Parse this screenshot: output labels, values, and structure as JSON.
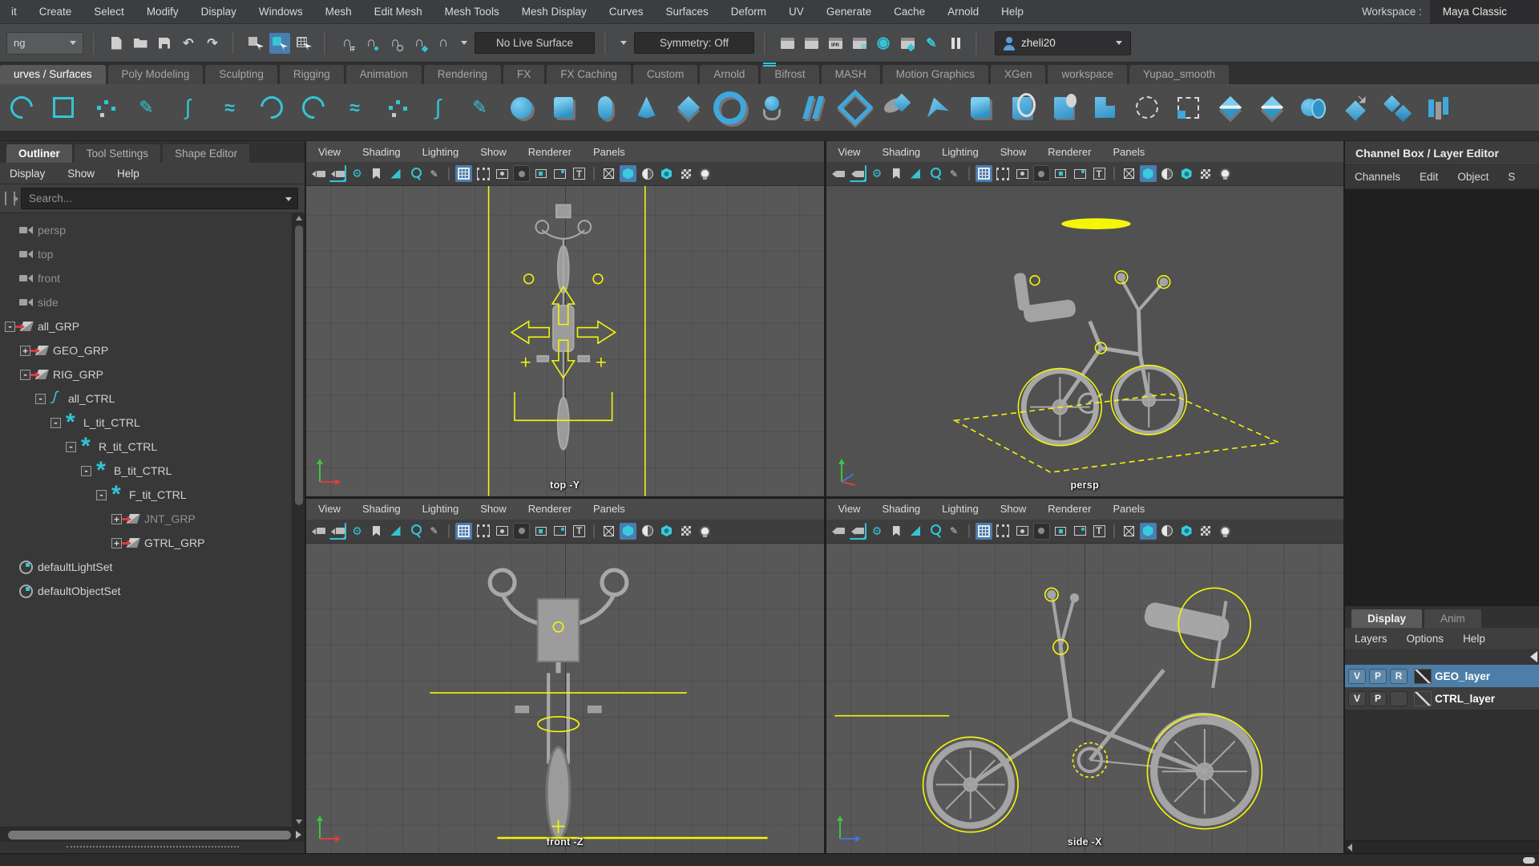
{
  "colors": {
    "accent_teal": "#35c4d6",
    "accent_blue": "#4a7db1",
    "selection_yellow": "#f5f50a",
    "layer_selected": "#4d7ea8"
  },
  "menubar": {
    "items": [
      "it",
      "Create",
      "Select",
      "Modify",
      "Display",
      "Windows",
      "Mesh",
      "Edit Mesh",
      "Mesh Tools",
      "Mesh Display",
      "Curves",
      "Surfaces",
      "Deform",
      "UV",
      "Generate",
      "Cache",
      "Arnold",
      "Help"
    ],
    "workspace_label": "Workspace :",
    "workspace_value": "Maya Classic"
  },
  "statusline": {
    "menuset_value": "ng",
    "file_icons": [
      {
        "n": "new-scene-icon",
        "c": "ic-new"
      },
      {
        "n": "open-scene-icon",
        "c": "ic-open"
      },
      {
        "n": "save-scene-icon",
        "c": "ic-save"
      },
      {
        "n": "undo-icon",
        "c": "ic-glyph",
        "g": "↶"
      },
      {
        "n": "redo-icon",
        "c": "ic-glyph",
        "g": "↷"
      }
    ],
    "select_icons": [
      {
        "n": "select-by-hierarchy-icon",
        "c": "ic-selhier"
      },
      {
        "n": "select-by-object-icon",
        "c": "ic-selobj on"
      },
      {
        "n": "select-by-component-icon",
        "c": "ic-selcomp"
      }
    ],
    "snap_icons": [
      {
        "n": "snap-to-grid-icon",
        "c": "ic-mag sub-grid",
        "g": "∩"
      },
      {
        "n": "snap-to-curve-icon",
        "c": "ic-mag sub-dot",
        "g": "∩"
      },
      {
        "n": "snap-to-point-icon",
        "c": "ic-mag sub-ring",
        "g": "∩"
      },
      {
        "n": "snap-to-projected-center-ic",
        "c": "ic-mag sub-diamond",
        "g": "∩"
      },
      {
        "n": "snap-to-view-plane-icon",
        "c": "ic-mag",
        "g": "∩"
      }
    ],
    "live_surface": "No Live Surface",
    "symmetry": "Symmetry: Off",
    "render_icons": [
      {
        "n": "render-current-frame-icon",
        "c": "ic-clap"
      },
      {
        "n": "render-region-icon",
        "c": "ic-clap"
      },
      {
        "n": "ipr-render-icon",
        "c": "ic-clap ipr"
      },
      {
        "n": "render-settings-icon",
        "c": "ic-clap gear"
      },
      {
        "n": "render-view-icon",
        "c": "ic-glyph teal big",
        "g": "◉"
      },
      {
        "n": "sequence-render-icon",
        "c": "ic-clap diam"
      },
      {
        "n": "paint-effects-icon",
        "c": "ic-glyph teal",
        "g": "✎"
      },
      {
        "n": "pause-ipr-icon",
        "c": "ic-pause"
      }
    ],
    "user": "zheli20"
  },
  "shelf": {
    "tabs": [
      {
        "label": "urves / Surfaces",
        "cls": "active"
      },
      {
        "label": "Poly Modeling"
      },
      {
        "label": "Sculpting"
      },
      {
        "label": "Rigging"
      },
      {
        "label": "Animation"
      },
      {
        "label": "Rendering"
      },
      {
        "label": "FX"
      },
      {
        "label": "FX Caching"
      },
      {
        "label": "Custom"
      },
      {
        "label": "Arnold"
      },
      {
        "label": "Bifrost"
      },
      {
        "label": "MASH"
      },
      {
        "label": "Motion Graphics"
      },
      {
        "label": "XGen"
      },
      {
        "label": "workspace"
      },
      {
        "label": "Yupao_smooth"
      }
    ],
    "icons": [
      {
        "n": "nurbs-circle-icon",
        "c": "s-arc"
      },
      {
        "n": "nurbs-square-icon",
        "c": "s-square"
      },
      {
        "n": "ep-curve-icon",
        "c": "s-points"
      },
      {
        "n": "pencil-curve-icon",
        "c": "s-pencil",
        "g": "✎"
      },
      {
        "n": "cv-curve-icon",
        "c": "s-int",
        "g": "∫"
      },
      {
        "n": "bezier-curve-icon",
        "c": "s-wave",
        "g": "≈"
      },
      {
        "n": "three-point-arc-icon",
        "c": "s-arc r2"
      },
      {
        "n": "two-point-arc-icon",
        "c": "s-arc"
      },
      {
        "n": "curve-fillet-icon",
        "c": "s-wave",
        "g": "≈"
      },
      {
        "n": "add-points-icon",
        "c": "s-points"
      },
      {
        "n": "curve-smooth-icon",
        "c": "s-int",
        "g": "∫"
      },
      {
        "n": "grease-pencil-curve-icon",
        "c": "s-pencil",
        "g": "✎"
      },
      {
        "n": "nurbs-sphere-icon",
        "c": "p-sphere"
      },
      {
        "n": "nurbs-cube-icon",
        "c": "p-cube"
      },
      {
        "n": "nurbs-cylinder-icon",
        "c": "p-cyl"
      },
      {
        "n": "nurbs-cone-icon",
        "c": "p-cone"
      },
      {
        "n": "nurbs-plane-icon",
        "c": "p-diamond"
      },
      {
        "n": "nurbs-torus-icon",
        "c": "p-torus"
      },
      {
        "n": "revolve-icon",
        "c": "p-revolve"
      },
      {
        "n": "loft-icon",
        "c": "p-loft"
      },
      {
        "n": "planar-icon",
        "c": "p-planar"
      },
      {
        "n": "extrude-icon",
        "c": "p-extrude"
      },
      {
        "n": "birail-icon",
        "c": "p-swoosh"
      },
      {
        "n": "boundary-icon",
        "c": "p-cube"
      },
      {
        "n": "square-surface-icon",
        "c": "p-rect-ell"
      },
      {
        "n": "bevel-icon",
        "c": "p-rect-sph"
      },
      {
        "n": "bevel-plus-icon",
        "c": "p-rect-l"
      },
      {
        "n": "project-curve-icon",
        "c": "p-dashcircle"
      },
      {
        "n": "trim-tool-icon",
        "c": "p-dashsquare"
      },
      {
        "n": "untrim-icon",
        "c": "p-dslash"
      },
      {
        "n": "intersect-surfaces-icon",
        "c": "p-dslash"
      },
      {
        "n": "attach-surfaces-icon",
        "c": "p-attach"
      },
      {
        "n": "detach-surfaces-icon",
        "c": "p-darrow"
      },
      {
        "n": "open-close-surface-icon",
        "c": "p-ddouble"
      },
      {
        "n": "rebuild-surface-icon",
        "c": "p-bars"
      }
    ]
  },
  "outliner": {
    "tabs": [
      {
        "label": "Outliner",
        "cls": "active"
      },
      {
        "label": "Tool Settings"
      },
      {
        "label": "Shape Editor"
      }
    ],
    "menus": [
      "Display",
      "Show",
      "Help"
    ],
    "search_placeholder": "Search...",
    "items": [
      {
        "label": "persp",
        "icon": "camera",
        "level": 0,
        "exp": "",
        "cls": "dim"
      },
      {
        "label": "top",
        "icon": "camera",
        "level": 0,
        "exp": "",
        "cls": "dim"
      },
      {
        "label": "front",
        "icon": "camera",
        "level": 0,
        "exp": "",
        "cls": "dim"
      },
      {
        "label": "side",
        "icon": "camera",
        "level": 0,
        "exp": "",
        "cls": "dim"
      },
      {
        "label": "all_GRP",
        "icon": "transform",
        "level": 0,
        "exp": "-"
      },
      {
        "label": "GEO_GRP",
        "icon": "transform",
        "level": 1,
        "exp": "+"
      },
      {
        "label": "RIG_GRP",
        "icon": "transform",
        "level": 1,
        "exp": "-"
      },
      {
        "label": "all_CTRL",
        "icon": "curve",
        "level": 2,
        "exp": "-"
      },
      {
        "label": "L_tit_CTRL",
        "icon": "star",
        "level": 3,
        "exp": "-"
      },
      {
        "label": "R_tit_CTRL",
        "icon": "star",
        "level": 4,
        "exp": "-"
      },
      {
        "label": "B_tit_CTRL",
        "icon": "star",
        "level": 5,
        "exp": "-"
      },
      {
        "label": "F_tit_CTRL",
        "icon": "star",
        "level": 6,
        "exp": "-"
      },
      {
        "label": "JNT_GRP",
        "icon": "transform",
        "level": 7,
        "exp": "+",
        "cls": "dim"
      },
      {
        "label": "GTRL_GRP",
        "icon": "transform",
        "level": 7,
        "exp": "+"
      },
      {
        "label": "defaultLightSet",
        "icon": "set",
        "level": 0,
        "exp": ""
      },
      {
        "label": "defaultObjectSet",
        "icon": "set",
        "level": 0,
        "exp": ""
      }
    ]
  },
  "viewport": {
    "menus": [
      "View",
      "Shading",
      "Lighting",
      "Show",
      "Renderer",
      "Panels"
    ],
    "toolbar_icons": [
      {
        "n": "camera-icon",
        "c": "ic-cam"
      },
      {
        "n": "camera-lock-icon",
        "c": "ic-cam lock"
      },
      {
        "n": "camera-attributes-icon",
        "c": "tealg",
        "g": "⚙"
      },
      {
        "n": "bookmark-icon",
        "c": "ic-bookmark"
      },
      {
        "n": "isolate-select-icon",
        "c": "ic-isolate"
      },
      {
        "n": "zoom-region-icon",
        "c": "ic-zoom"
      },
      {
        "n": "grease-pencil-icon",
        "c": "dim",
        "g": "✎"
      },
      {
        "n": "separator",
        "c": "vsep"
      },
      {
        "n": "grid-icon",
        "c": "ic-grid on"
      },
      {
        "n": "film-gate-icon",
        "c": "ic-film"
      },
      {
        "n": "resolution-gate-icon",
        "c": "ic-resgate"
      },
      {
        "n": "gate-mask-icon",
        "c": "ic-gatemask pressed"
      },
      {
        "n": "field-chart-icon",
        "c": "ic-region"
      },
      {
        "n": "image-plane-icon",
        "c": "ic-imgplane"
      },
      {
        "n": "hud-icon",
        "c": "ic-hud",
        "g": "T"
      },
      {
        "n": "separator",
        "c": "vsep"
      },
      {
        "n": "wireframe-icon",
        "c": "ic-wirecube"
      },
      {
        "n": "shaded-icon",
        "c": "ic-shadedcube on"
      },
      {
        "n": "default-material-icon",
        "c": "ic-halfsphere"
      },
      {
        "n": "textured-icon",
        "c": "ic-texcube"
      },
      {
        "n": "wireframe-on-shaded-icon",
        "c": "ic-checker"
      },
      {
        "n": "lights-icon",
        "c": "ic-bulb"
      }
    ],
    "views": [
      {
        "label": "top -Y"
      },
      {
        "label": "persp"
      },
      {
        "label": "front -Z"
      },
      {
        "label": "side -X"
      }
    ]
  },
  "channel_box": {
    "title": "Channel Box / Layer Editor",
    "menus": [
      "Channels",
      "Edit",
      "Object",
      "S"
    ]
  },
  "layer_editor": {
    "tabs": [
      {
        "label": "Display",
        "cls": "active"
      },
      {
        "label": "Anim"
      }
    ],
    "menus": [
      "Layers",
      "Options",
      "Help"
    ],
    "rows": [
      {
        "v": "V",
        "p": "P",
        "r": "R",
        "label": "GEO_layer",
        "cls": "selected"
      },
      {
        "v": "V",
        "p": "P",
        "r": "",
        "label": "CTRL_layer",
        "cls": ""
      }
    ]
  }
}
